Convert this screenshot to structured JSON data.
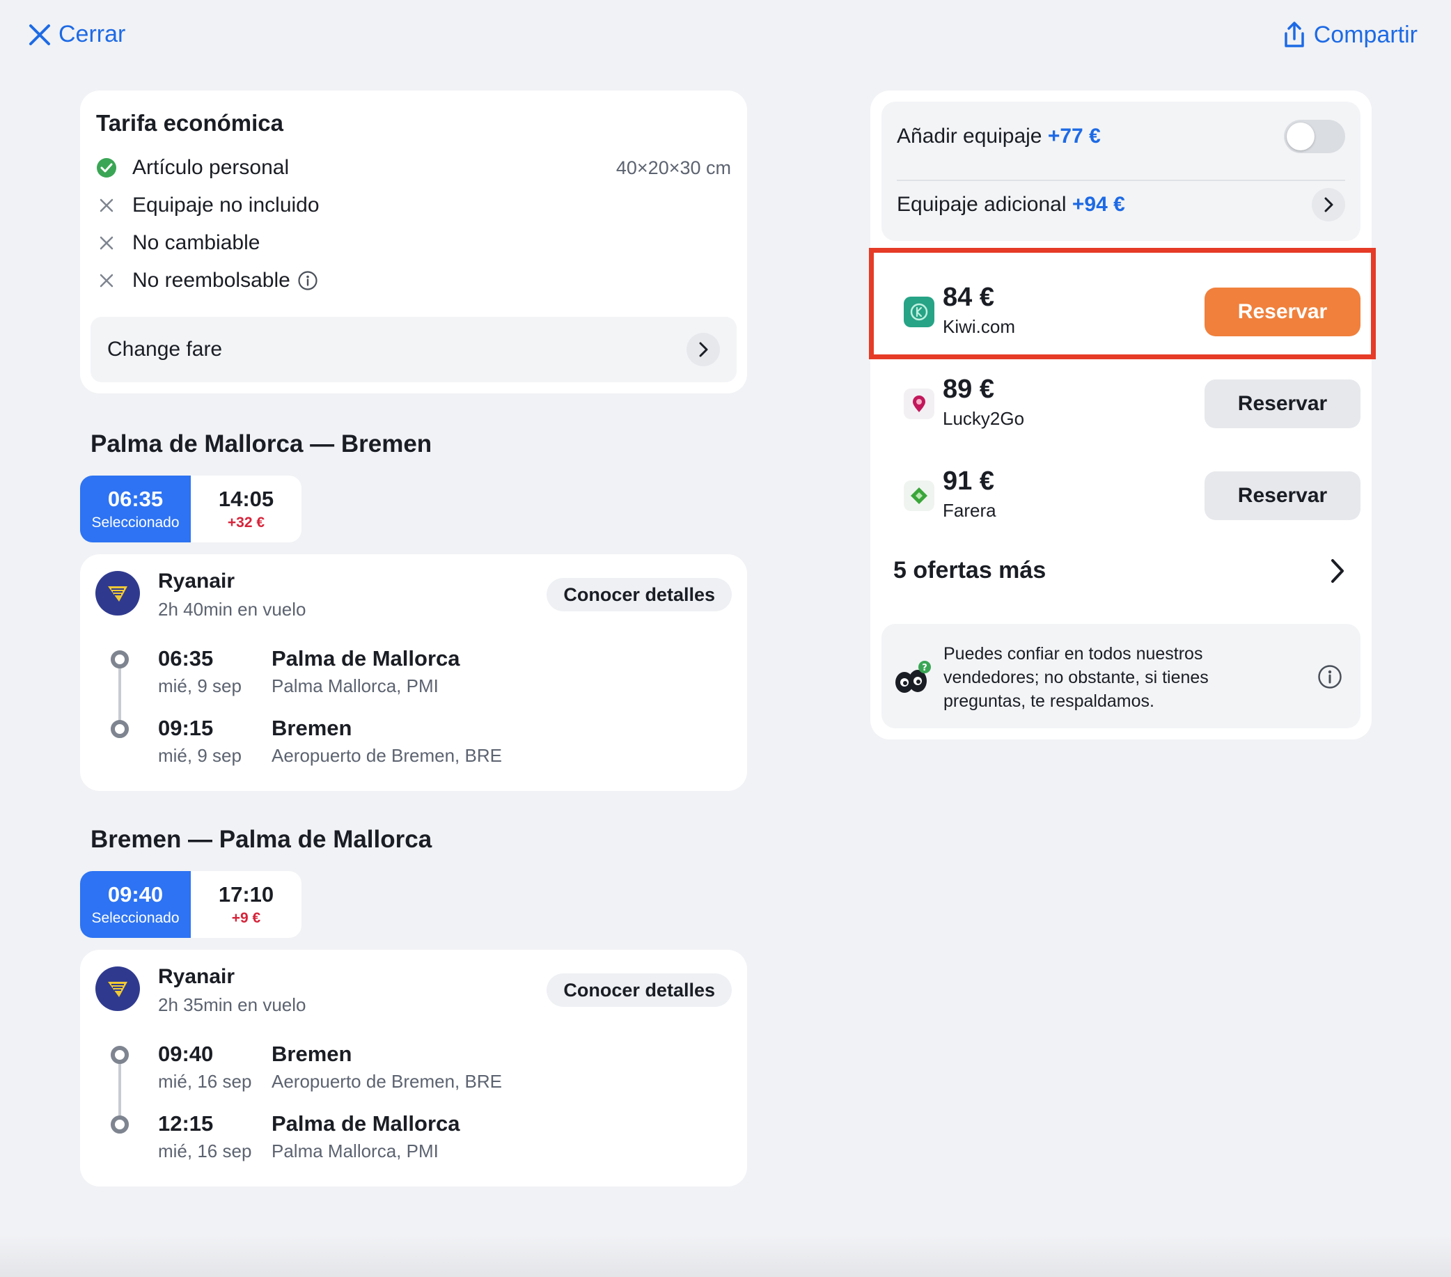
{
  "topbar": {
    "close_label": "Cerrar",
    "share_label": "Compartir"
  },
  "fare": {
    "title": "Tarifa económica",
    "items": [
      {
        "label": "Artículo personal",
        "included": true,
        "size": "40×20×30 cm"
      },
      {
        "label": "Equipaje no incluido",
        "included": false
      },
      {
        "label": "No cambiable",
        "included": false
      },
      {
        "label": "No reembolsable",
        "included": false
      }
    ],
    "change_fare_label": "Change fare"
  },
  "outbound": {
    "title": "Palma de Mallorca — Bremen",
    "tabs": [
      {
        "time": "06:35",
        "sub": "Seleccionado",
        "selected": true
      },
      {
        "time": "14:05",
        "sub": "+32 €",
        "selected": false
      }
    ],
    "airline": "Ryanair",
    "duration": "2h 40min en vuelo",
    "details_label": "Conocer detalles",
    "depart": {
      "time": "06:35",
      "date": "mié, 9 sep",
      "city": "Palma de Mallorca",
      "airport": "Palma Mallorca, PMI"
    },
    "arrive": {
      "time": "09:15",
      "date": "mié, 9 sep",
      "city": "Bremen",
      "airport": "Aeropuerto de Bremen, BRE"
    }
  },
  "inbound": {
    "title": "Bremen — Palma de Mallorca",
    "tabs": [
      {
        "time": "09:40",
        "sub": "Seleccionado",
        "selected": true
      },
      {
        "time": "17:10",
        "sub": "+9 €",
        "selected": false
      }
    ],
    "airline": "Ryanair",
    "duration": "2h 35min en vuelo",
    "details_label": "Conocer detalles",
    "depart": {
      "time": "09:40",
      "date": "mié, 16 sep",
      "city": "Bremen",
      "airport": "Aeropuerto de Bremen, BRE"
    },
    "arrive": {
      "time": "12:15",
      "date": "mié, 16 sep",
      "city": "Palma de Mallorca",
      "airport": "Palma Mallorca, PMI"
    }
  },
  "baggage": {
    "add_label": "Añadir equipaje",
    "add_price": "+77 €",
    "add_enabled": false,
    "extra_label": "Equipaje adicional",
    "extra_price": "+94 €"
  },
  "offers": [
    {
      "price": "84 €",
      "vendor": "Kiwi.com",
      "book_label": "Reservar",
      "logo": "kiwi-logo",
      "color": "#27a386",
      "highlighted": true
    },
    {
      "price": "89 €",
      "vendor": "Lucky2Go",
      "book_label": "Reservar",
      "logo": "lucky2go-logo",
      "color": "#c2185b"
    },
    {
      "price": "91 €",
      "vendor": "Farera",
      "book_label": "Reservar",
      "logo": "farera-logo",
      "color": "#3aa63a"
    }
  ],
  "more_offers_label": "5 ofertas más",
  "trust_text": "Puedes confiar en todos nuestros vendedores; no obstante, si tienes preguntas, te respaldamos.",
  "colors": {
    "accent": "#1d6ae5",
    "selected_tab": "#2d73f3",
    "book_primary": "#f0803c",
    "highlight_border": "#e53b27",
    "price_delta": "#d6243a"
  }
}
